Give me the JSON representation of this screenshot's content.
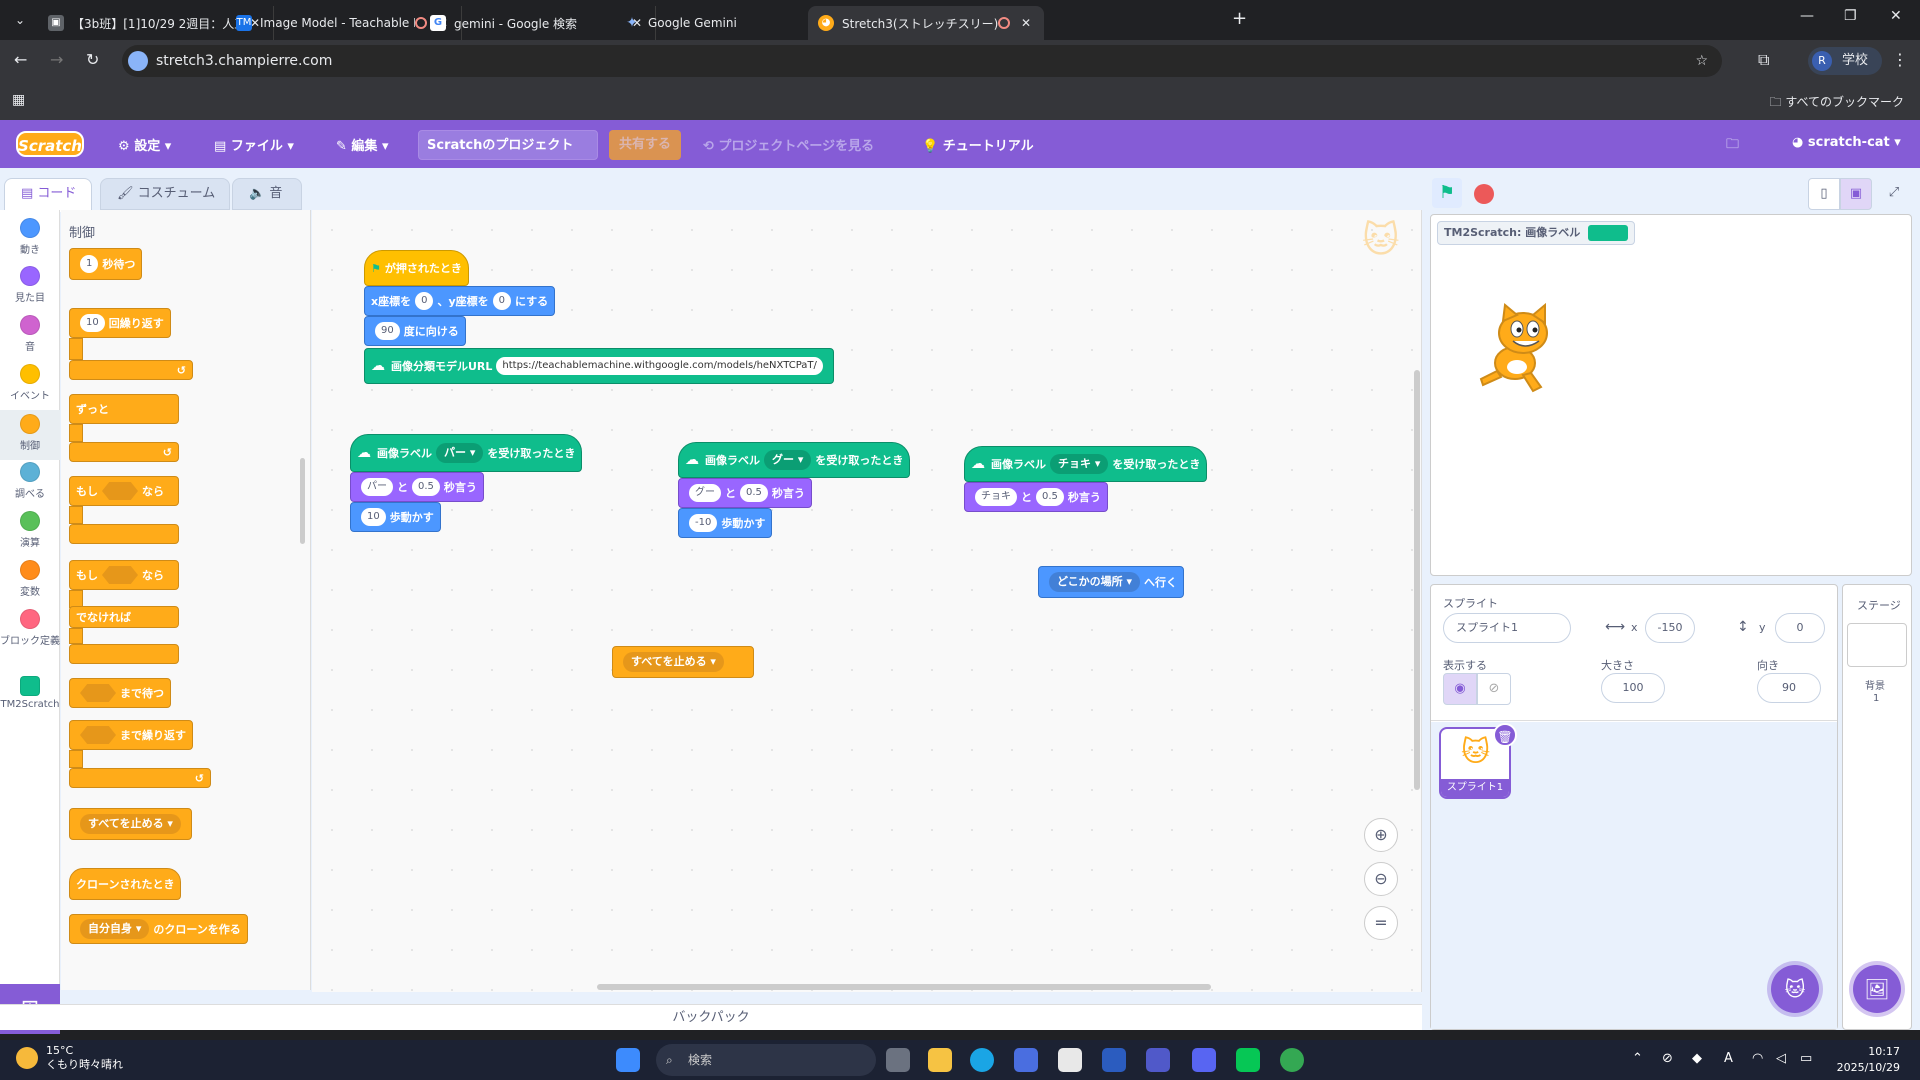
{
  "browser": {
    "tabs": [
      {
        "title": "【3b班】[1]10/29 2週目：人工知",
        "icon": "classroom-icon"
      },
      {
        "title": "Image Model - Teachable M",
        "icon": "tm-icon"
      },
      {
        "title": "gemini - Google 検索",
        "icon": "google-icon"
      },
      {
        "title": "Google Gemini",
        "icon": "gemini-icon"
      },
      {
        "title": "Stretch3(ストレッチスリー)",
        "icon": "scratch-cat-icon"
      }
    ],
    "url": "stretch3.champierre.com",
    "profile_initial": "R",
    "profile_label": "学校",
    "bookmarks_label": "すべてのブックマーク"
  },
  "menu": {
    "logo": "Scratch",
    "settings": "設定",
    "file": "ファイル",
    "edit": "編集",
    "project_title": "Scratchのプロジェクト",
    "share": "共有する",
    "see_project": "プロジェクトページを見る",
    "tutorial": "チュートリアル",
    "user": "scratch-cat"
  },
  "editor_tabs": {
    "code": "コード",
    "costume": "コスチューム",
    "sound": "音"
  },
  "categories": [
    {
      "label": "動き",
      "color": "#4c97ff"
    },
    {
      "label": "見た目",
      "color": "#9966ff"
    },
    {
      "label": "音",
      "color": "#cf63cf"
    },
    {
      "label": "イベント",
      "color": "#ffbf00"
    },
    {
      "label": "制御",
      "color": "#ffab19"
    },
    {
      "label": "調べる",
      "color": "#5cb1d6"
    },
    {
      "label": "演算",
      "color": "#59c059"
    },
    {
      "label": "変数",
      "color": "#ff8c1a"
    },
    {
      "label": "ブロック定義",
      "color": "#ff6680"
    },
    {
      "label": "TM2Scratch",
      "color": "#0fbd8c"
    }
  ],
  "palette": {
    "heading": "制御",
    "wait_num": "1",
    "wait": "秒待つ",
    "repeat_num": "10",
    "repeat": "回繰り返す",
    "forever": "ずっと",
    "if": "もし",
    "then": "なら",
    "if2": "もし",
    "then2": "なら",
    "else": "でなければ",
    "wait_until": "まで待つ",
    "repeat_until": "まで繰り返す",
    "stop_all": "すべてを止める",
    "when_clone": "クローンされたとき",
    "clone_target": "自分自身",
    "create_clone": "のクローンを作る"
  },
  "scripts": {
    "s1": {
      "hat": "が押されたとき",
      "goto_x_label": "x座標を",
      "goto_x": "0",
      "goto_y_label": "、y座標を",
      "goto_y": "0",
      "goto_end": "にする",
      "point": "90",
      "point_label": "度に向ける",
      "model_label": "画像分類モデルURL",
      "model_url": "https://teachablemachine.withgoogle.com/models/heNXTCPaT/"
    },
    "s2": {
      "hat_label": "画像ラベル",
      "label": "パー",
      "hat_end": "を受け取ったとき",
      "say": "パー",
      "and": "と",
      "secs": "0.5",
      "say_end": "秒言う",
      "move": "10",
      "move_end": "歩動かす"
    },
    "s3": {
      "hat_label": "画像ラベル",
      "label": "グー",
      "hat_end": "を受け取ったとき",
      "say": "グー",
      "and": "と",
      "secs": "0.5",
      "say_end": "秒言う",
      "move": "-10",
      "move_end": "歩動かす"
    },
    "s4": {
      "hat_label": "画像ラベル",
      "label": "チョキ",
      "hat_end": "を受け取ったとき",
      "say": "チョキ",
      "and": "と",
      "secs": "0.5",
      "say_end": "秒言う"
    },
    "s5": {
      "target": "どこかの場所",
      "end": "へ行く"
    },
    "s6": {
      "stop": "すべてを止める"
    }
  },
  "backpack": "バックパック",
  "stage": {
    "monitor_label": "TM2Scratch: 画像ラベル"
  },
  "sprite_info": {
    "heading": "スプライト",
    "name": "スプライト1",
    "x_label": "x",
    "x": "-150",
    "y_label": "y",
    "y": "0",
    "show": "表示する",
    "size_label": "大きさ",
    "size": "100",
    "direction_label": "向き",
    "direction": "90",
    "thumb_label": "スプライト1"
  },
  "stage_pane": {
    "heading": "ステージ",
    "backdrop_label": "背景",
    "backdrop_count": "1"
  },
  "taskbar": {
    "temp": "15°C",
    "weather": "くもり時々晴れ",
    "search": "検索",
    "time": "10:17",
    "date": "2025/10/29"
  }
}
